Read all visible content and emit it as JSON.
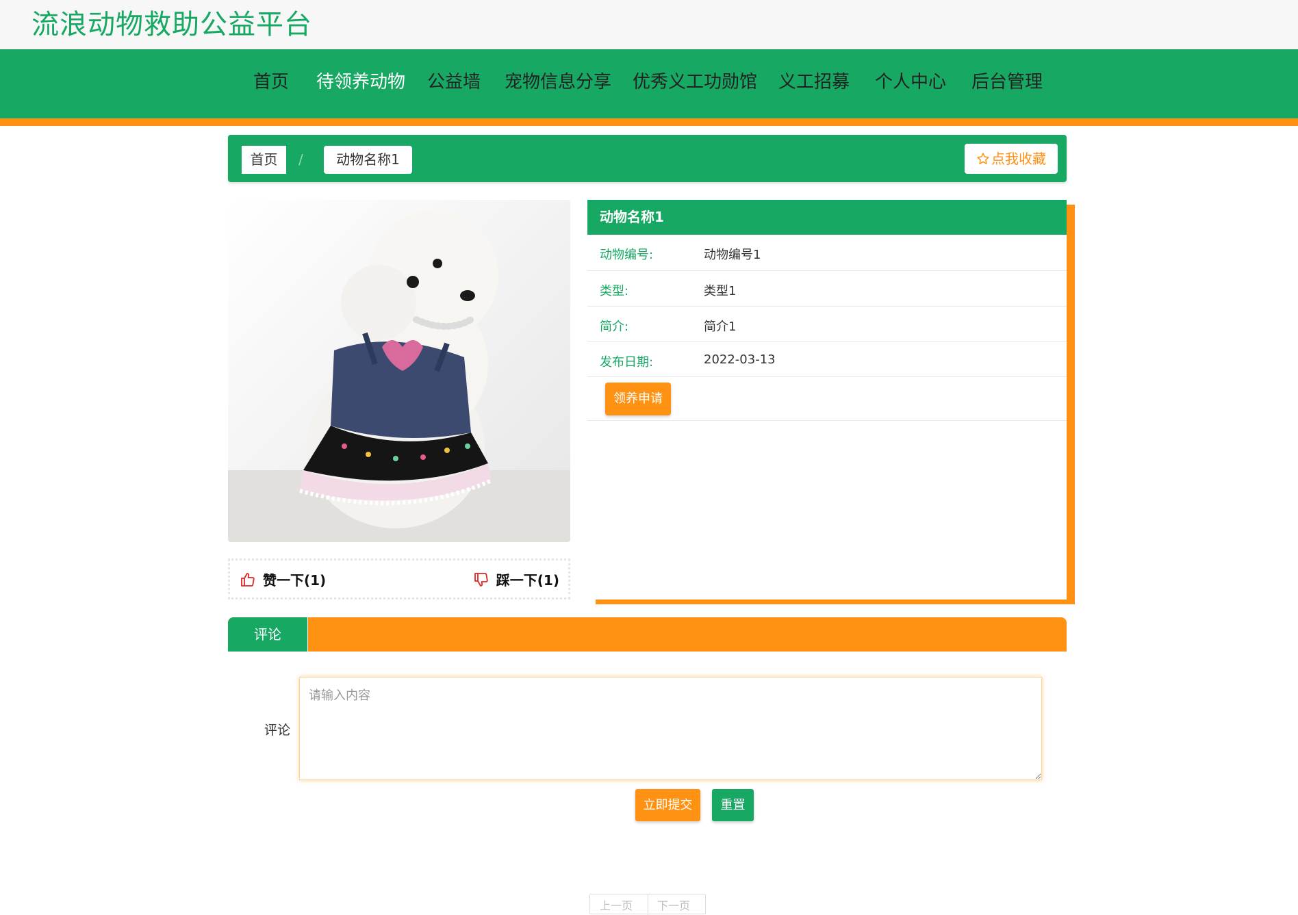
{
  "site": {
    "title": "流浪动物救助公益平台"
  },
  "nav": {
    "items": [
      {
        "label": "首页",
        "active": false
      },
      {
        "label": "待领养动物",
        "active": true
      },
      {
        "label": "公益墙",
        "active": false
      },
      {
        "label": "宠物信息分享",
        "active": false
      },
      {
        "label": "优秀义工功勋馆",
        "active": false
      },
      {
        "label": "义工招募",
        "active": false
      },
      {
        "label": "个人中心",
        "active": false
      },
      {
        "label": "后台管理",
        "active": false
      }
    ]
  },
  "breadcrumb": {
    "home": "首页",
    "separator": "/",
    "current": "动物名称1"
  },
  "favorite": {
    "label": "点我收藏",
    "icon": "star-outline-icon"
  },
  "photo": {
    "alt": "poodle-dog-photo"
  },
  "reactions": {
    "like_label": "赞一下(1)",
    "dislike_label": "踩一下(1)",
    "like_icon": "thumbs-up-icon",
    "dislike_icon": "thumbs-down-icon"
  },
  "detail": {
    "title": "动物名称1",
    "fields": [
      {
        "label": "动物编号:",
        "value": "动物编号1"
      },
      {
        "label": "类型:",
        "value": "类型1"
      },
      {
        "label": "简介:",
        "value": "简介1"
      },
      {
        "label": "发布日期:",
        "value": "2022-03-13"
      }
    ],
    "adopt_button": "领养申请"
  },
  "tabs": {
    "comment_tab": "评论"
  },
  "comment_form": {
    "label": "评论",
    "placeholder": "请输入内容",
    "value": "",
    "submit": "立即提交",
    "reset": "重置"
  },
  "pager": {
    "prev": "上一页",
    "next": "下一页"
  },
  "colors": {
    "primary": "#17a863",
    "accent": "#ff9113",
    "topbar": "#f7f7f7"
  }
}
